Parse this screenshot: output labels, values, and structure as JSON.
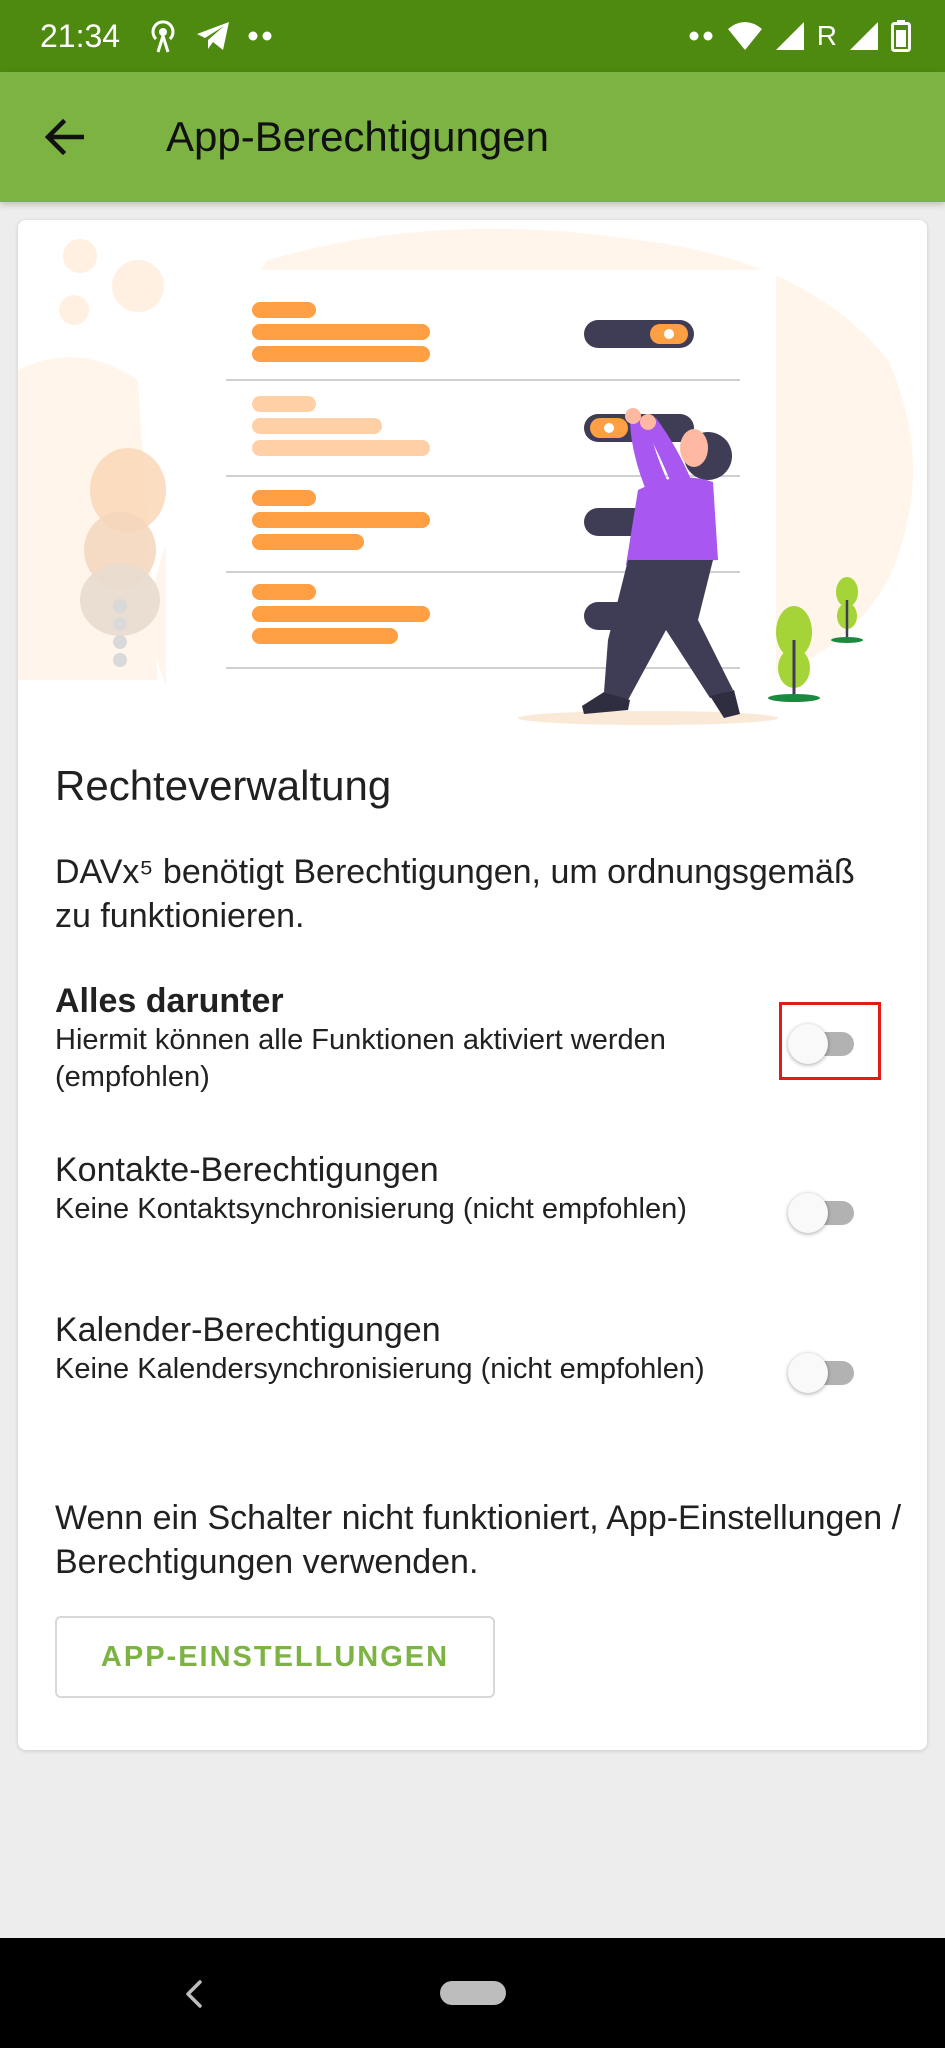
{
  "status_bar": {
    "time": "21:34",
    "network_label": "R",
    "left_icons": [
      "hotspot-icon",
      "telegram-icon",
      "more-dots-icon"
    ],
    "right_icons": [
      "more-dots-icon",
      "wifi-icon",
      "signal-icon",
      "signal-icon",
      "battery-icon"
    ]
  },
  "app_bar": {
    "title": "App-Berechtigungen",
    "back_icon": "arrow-back-icon",
    "background": "#7cb342"
  },
  "content": {
    "section_title": "Rechteverwaltung",
    "intro": "DAVx⁵ benötigt Berechtigungen, um ordnungsgemäß zu funktionieren.",
    "permissions": [
      {
        "title": "Alles darunter",
        "description": "Hiermit können alle Funktionen aktiviert werden (empfohlen)",
        "enabled": false
      },
      {
        "title": "Kontakte-Berechtigungen",
        "description": "Keine Kontaktsynchronisierung (nicht empfohlen)",
        "enabled": false
      },
      {
        "title": "Kalender-Berechtigungen",
        "description": "Keine Kalendersynchronisierung (nicht empfohlen)",
        "enabled": false
      }
    ],
    "hint": "Wenn ein Schalter nicht funktioniert, App-Einstellungen / Berechtigungen verwenden.",
    "settings_button": "APP-EINSTELLUNGEN"
  },
  "colors": {
    "status_bar": "#4d8a0f",
    "accent": "#7cb342",
    "illustration_orange": "#ff9f43",
    "illustration_purple": "#a857f0",
    "highlight": "#e21a1a"
  },
  "nav_bar": {
    "icons": [
      "nav-back-icon",
      "nav-home-pill"
    ]
  }
}
